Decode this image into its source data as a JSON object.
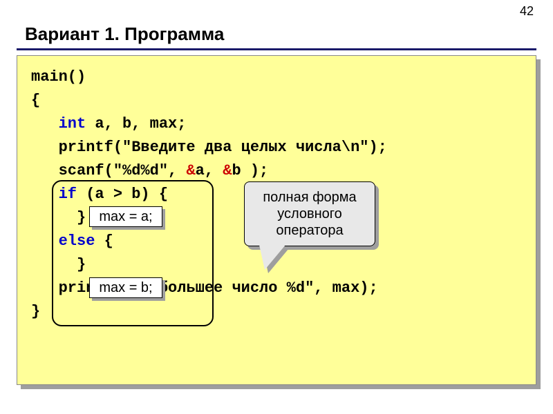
{
  "page_number": "42",
  "title": "Вариант 1. Программа",
  "code": {
    "l1": "main()",
    "l2": "{",
    "l3_pre": "   ",
    "l3_kw": "int",
    "l3_rest": " a, b, max;",
    "l4_pre": "   printf(\"Введите два целых числа\\n\");",
    "l5_pre": "   scanf(\"%d%d\", ",
    "l5_amp1": "&",
    "l5_mid1": "a, ",
    "l5_amp2": "&",
    "l5_mid2": "b );",
    "l6_pre": "   ",
    "l6_kw": "if",
    "l6_rest": " (a > b) {",
    "l7": "",
    "l8": "     }",
    "l9_pre": "   ",
    "l9_kw": "else",
    "l9_rest": " {",
    "l10": "",
    "l11": "     }",
    "l12": "   printf(\"Наибольшее число %d\", max);",
    "l13": "}"
  },
  "chip_a": "max = a;",
  "chip_b": "max = b;",
  "callout": "полная форма условного оператора"
}
